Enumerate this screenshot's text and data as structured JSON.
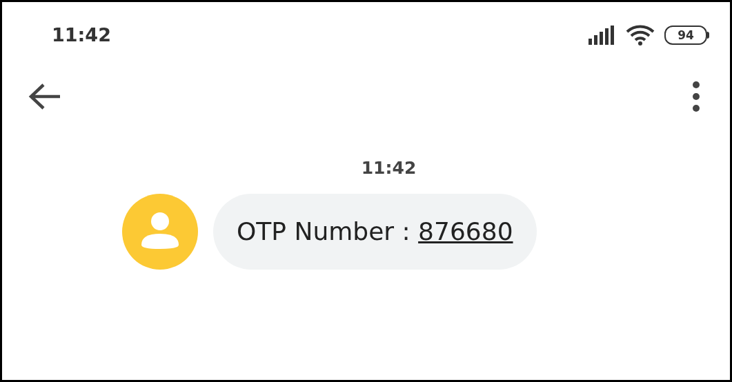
{
  "status_bar": {
    "time": "11:42",
    "battery": "94"
  },
  "conversation": {
    "timestamp": "11:42",
    "messages": [
      {
        "text": "OTP Number : ",
        "link": "876680"
      }
    ]
  }
}
